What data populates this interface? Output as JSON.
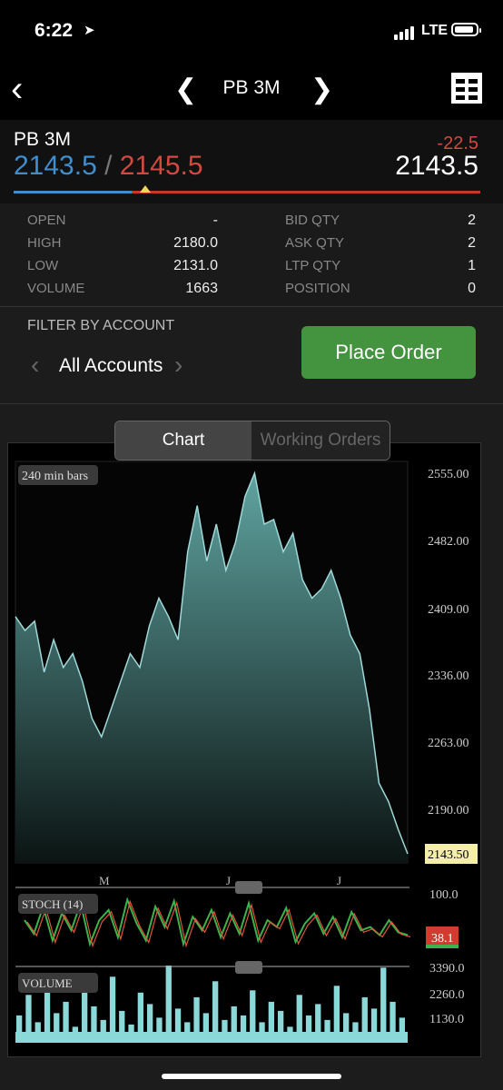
{
  "status": {
    "time": "6:22",
    "carrier": "LTE"
  },
  "nav": {
    "title": "PB 3M"
  },
  "quote": {
    "symbol": "PB 3M",
    "bid": "2143.5",
    "separator": "/",
    "ask": "2145.5",
    "change": "-22.5",
    "last": "2143.5"
  },
  "stats": {
    "left": [
      {
        "label": "OPEN",
        "value": "-"
      },
      {
        "label": "HIGH",
        "value": "2180.0"
      },
      {
        "label": "LOW",
        "value": "2131.0"
      },
      {
        "label": "VOLUME",
        "value": "1663"
      }
    ],
    "right": [
      {
        "label": "BID QTY",
        "value": "2"
      },
      {
        "label": "ASK QTY",
        "value": "2"
      },
      {
        "label": "LTP QTY",
        "value": "1"
      },
      {
        "label": "POSITION",
        "value": "0"
      }
    ]
  },
  "filter": {
    "label": "FILTER BY ACCOUNT",
    "account": "All Accounts",
    "place_order": "Place Order"
  },
  "tabs": {
    "chart": "Chart",
    "working_orders": "Working Orders"
  },
  "chart": {
    "bars_label": "240 min bars",
    "price_axis": [
      "2555.00",
      "2482.00",
      "2409.00",
      "2336.00",
      "2263.00",
      "2190.00"
    ],
    "last_price_tag": "2143.50",
    "x_labels": [
      "M",
      "J",
      "J"
    ],
    "stoch_label": "STOCH (14)",
    "stoch_axis": "100.0",
    "stoch_tag": "38.1",
    "volume_label": "VOLUME",
    "volume_axis": [
      "3390.0",
      "2260.0",
      "1130.0"
    ]
  },
  "chart_data": {
    "type": "area",
    "title": "240 min bars",
    "y_range": [
      2143.5,
      2555
    ],
    "series": [
      {
        "values": [
          2400,
          2385,
          2395,
          2340,
          2375,
          2345,
          2360,
          2330,
          2290,
          2270,
          2300,
          2330,
          2360,
          2345,
          2390,
          2420,
          2400,
          2375,
          2470,
          2520,
          2460,
          2500,
          2450,
          2480,
          2530,
          2555,
          2500,
          2505,
          2470,
          2490,
          2440,
          2420,
          2430,
          2450,
          2420,
          2380,
          2360,
          2300,
          2220,
          2200,
          2170,
          2143.5
        ]
      }
    ],
    "stoch": [
      60,
      40,
      80,
      30,
      70,
      45,
      85,
      25,
      60,
      75,
      35,
      90,
      55,
      30,
      80,
      50,
      88,
      25,
      65,
      45,
      75,
      35,
      70,
      40,
      85,
      30,
      60,
      50,
      78,
      28,
      55,
      70,
      40,
      65,
      35,
      72,
      45,
      50,
      38,
      60,
      42,
      38.1
    ],
    "volume": [
      1200,
      2100,
      900,
      2600,
      1300,
      1800,
      700,
      2400,
      1600,
      1000,
      2900,
      1400,
      800,
      2200,
      1700,
      1100,
      3390,
      1500,
      900,
      2000,
      1300,
      2700,
      1000,
      1600,
      1200,
      2300,
      900,
      1800,
      1400,
      700,
      2100,
      1200,
      1700,
      1000,
      2500,
      1300,
      900,
      2000,
      1500,
      3300,
      1800,
      1100
    ]
  }
}
